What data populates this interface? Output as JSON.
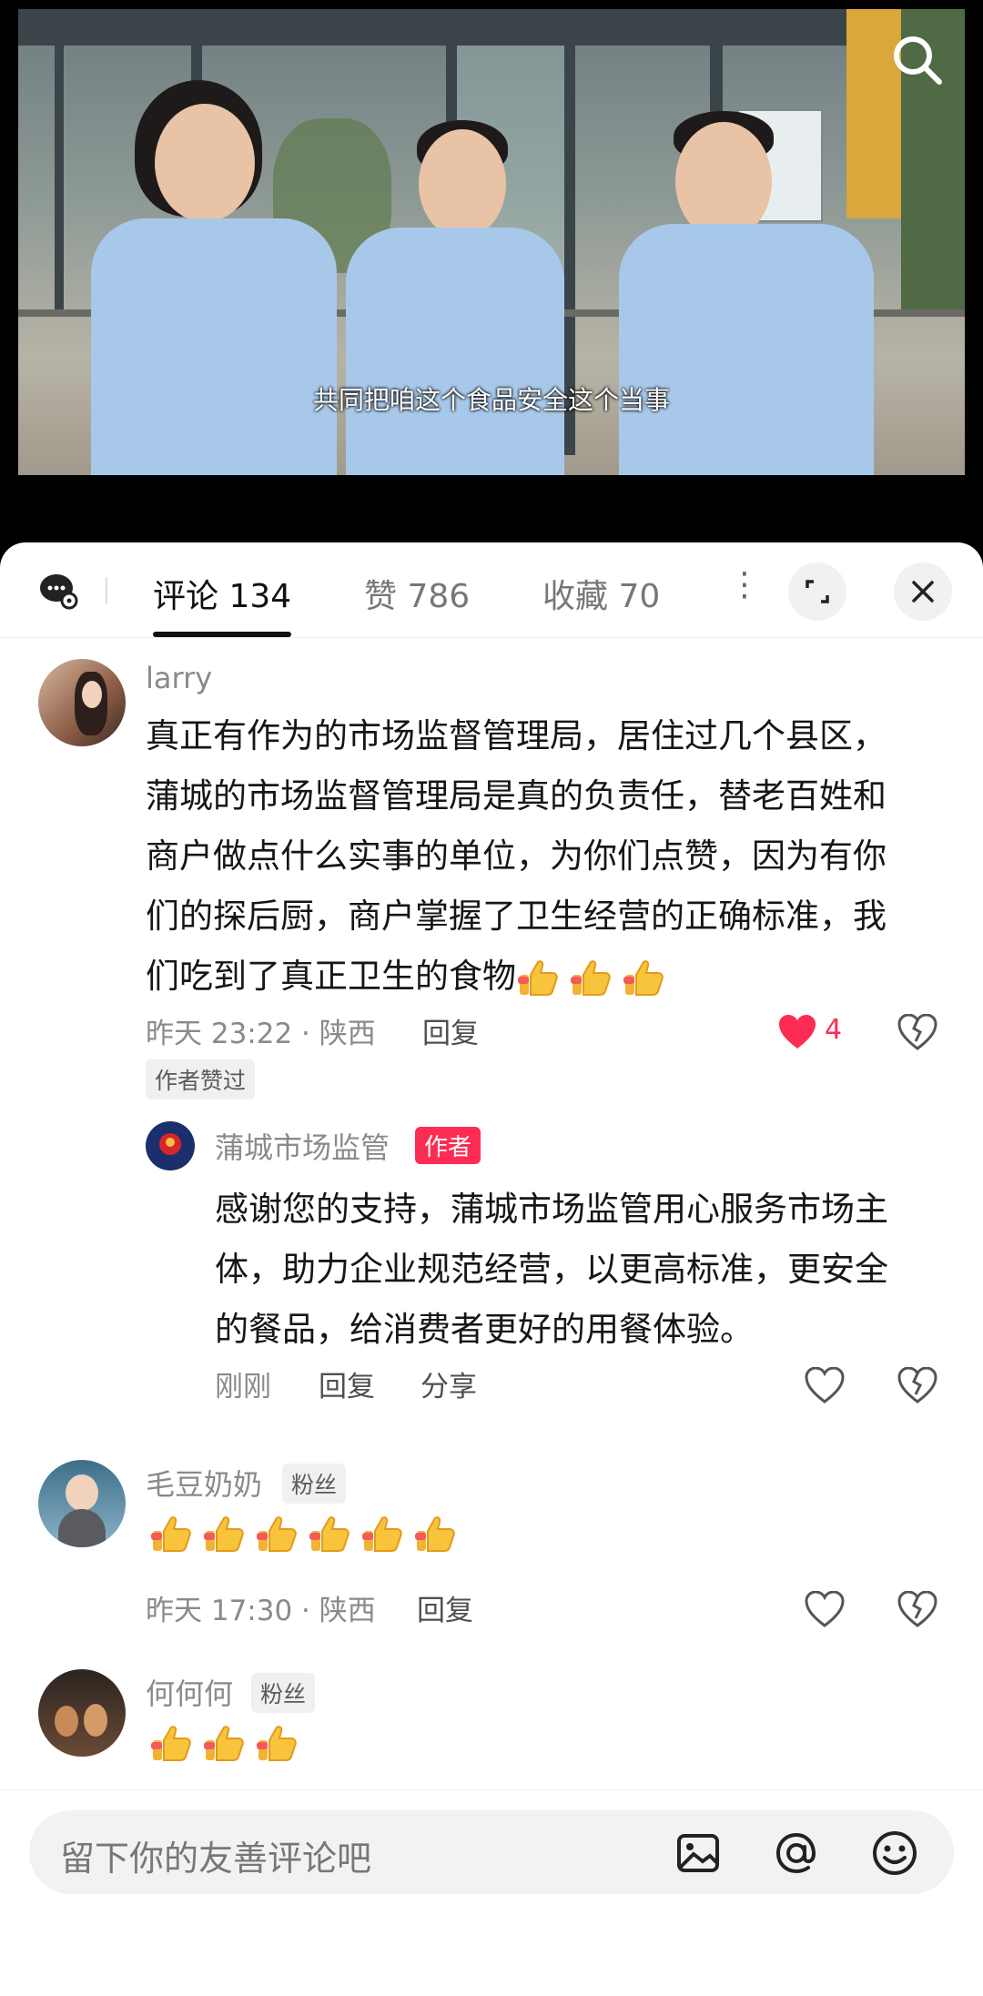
{
  "video": {
    "subtitle": "共同把咱这个食品安全这个当事"
  },
  "tabs": {
    "comments_label": "评论 134",
    "likes_label": "赞 786",
    "favorites_label": "收藏 70",
    "more": "⋮"
  },
  "comments": [
    {
      "username": "larry",
      "lines": [
        "真正有作为的市场监督管理局，居住过几个县区，",
        "蒲城的市场监督管理局是真的负责任，替老百姓和",
        "商户做点什么实事的单位，为你们点赞，因为有你",
        "们的探后厨，商户掌握了卫生经营的正确标准，我",
        "们吃到了真正卫生的食物"
      ],
      "time": "昨天 23:22 · 陕西",
      "reply": "回复",
      "likes": "4",
      "author_liked": "作者赞过",
      "thumbs": 3
    },
    {
      "username": "蒲城市场监管",
      "author_tag": "作者",
      "lines": [
        "感谢您的支持，蒲城市场监管用心服务市场主",
        "体，助力企业规范经营，以更高标准，更安全",
        "的餐品，给消费者更好的用餐体验。"
      ],
      "time": "刚刚",
      "reply": "回复",
      "share": "分享"
    },
    {
      "username": "毛豆奶奶",
      "fan_tag": "粉丝",
      "thumbs": 6,
      "time": "昨天 17:30 · 陕西",
      "reply": "回复"
    },
    {
      "username": "何何何",
      "fan_tag": "粉丝",
      "thumbs": 3
    }
  ],
  "input": {
    "placeholder": "留下你的友善评论吧"
  },
  "colors": {
    "accent": "#fe2c55",
    "shirt": "#a8c8ea"
  }
}
